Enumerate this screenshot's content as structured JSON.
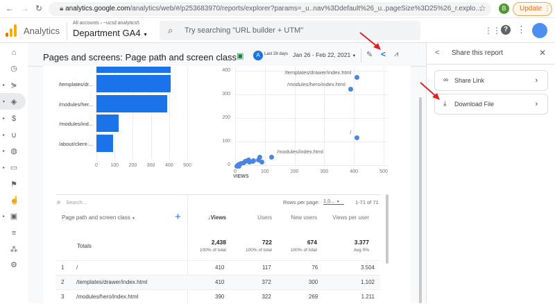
{
  "browser": {
    "url_domain": "analytics.google.com",
    "url_rest": "/analytics/web/#/p253683970/reports/explorer?params=_u..nav%3Ddefault%26_u..pageSize%3D25%26_r.explo...",
    "profile_initial": "B",
    "update_label": "Update"
  },
  "header": {
    "product": "Analytics",
    "breadcrumb": "All accounts › ~ucsd analytics5",
    "property": "Department GA4",
    "search_placeholder": "Try searching \"URL builder + UTM\""
  },
  "report": {
    "title": "Pages and screens: Page path and screen class",
    "comparison_initial": "A",
    "date_preset": "Last 28 days",
    "date_range": "Jan 26 - Feb 22, 2021"
  },
  "share_panel": {
    "title": "Share this report",
    "options": [
      {
        "label": "Share Link"
      },
      {
        "label": "Download File"
      }
    ]
  },
  "chart_data": [
    {
      "type": "bar",
      "categories": [
        "/",
        "/templates/dr...",
        "/modules/her...",
        "/modules/ind...",
        "/about/client-..."
      ],
      "values": [
        410,
        410,
        390,
        122,
        90
      ],
      "xlim": [
        0,
        500
      ],
      "xticks": [
        "0",
        "100",
        "200",
        "300",
        "400",
        "500"
      ]
    },
    {
      "type": "scatter",
      "xlabel": "VIEWS",
      "xlim": [
        0,
        500
      ],
      "ylim": [
        0,
        400
      ],
      "xticks": [
        "0",
        "100",
        "200",
        "300",
        "400",
        "500"
      ],
      "yticks": [
        "0",
        "100",
        "200",
        "300",
        "400"
      ],
      "points": [
        {
          "x": 410,
          "y": 372,
          "label": "/templates/drawer/index.html"
        },
        {
          "x": 390,
          "y": 322,
          "label": "/modules/hero/index.html"
        },
        {
          "x": 410,
          "y": 117,
          "label": "/"
        },
        {
          "x": 122,
          "y": 35,
          "label": "/modules/index.html"
        },
        {
          "x": 83,
          "y": 35
        },
        {
          "x": 90,
          "y": 12
        },
        {
          "x": 78,
          "y": 22
        },
        {
          "x": 60,
          "y": 16
        },
        {
          "x": 62,
          "y": 20
        },
        {
          "x": 45,
          "y": 22
        },
        {
          "x": 47,
          "y": 12
        },
        {
          "x": 40,
          "y": 18
        },
        {
          "x": 35,
          "y": 15
        },
        {
          "x": 30,
          "y": 10
        },
        {
          "x": 20,
          "y": 8
        },
        {
          "x": 15,
          "y": 5
        },
        {
          "x": 10,
          "y": 2
        },
        {
          "x": 8,
          "y": -2
        },
        {
          "x": 5,
          "y": -5
        },
        {
          "x": 12,
          "y": -3
        }
      ]
    }
  ],
  "table": {
    "search_placeholder": "Search...",
    "rows_per_page_label": "Rows per page:",
    "rows_per_page_value": "1,0...",
    "pagination": "1-71 of 71",
    "columns": [
      "Page path and screen class",
      "↓Views",
      "Users",
      "New users",
      "Views per user"
    ],
    "totals": {
      "label": "Totals",
      "values": [
        "2,438",
        "722",
        "674",
        "3.377"
      ],
      "subs": [
        "100% of total",
        "100% of total",
        "100% of total",
        "Avg 0%"
      ]
    },
    "rows": [
      [
        "1",
        "/",
        "410",
        "117",
        "76",
        "3.504"
      ],
      [
        "2",
        "/templates/drawer/index.html",
        "410",
        "372",
        "300",
        "1.102"
      ],
      [
        "3",
        "/modules/hero/index.html",
        "390",
        "322",
        "269",
        "1.211"
      ]
    ]
  }
}
